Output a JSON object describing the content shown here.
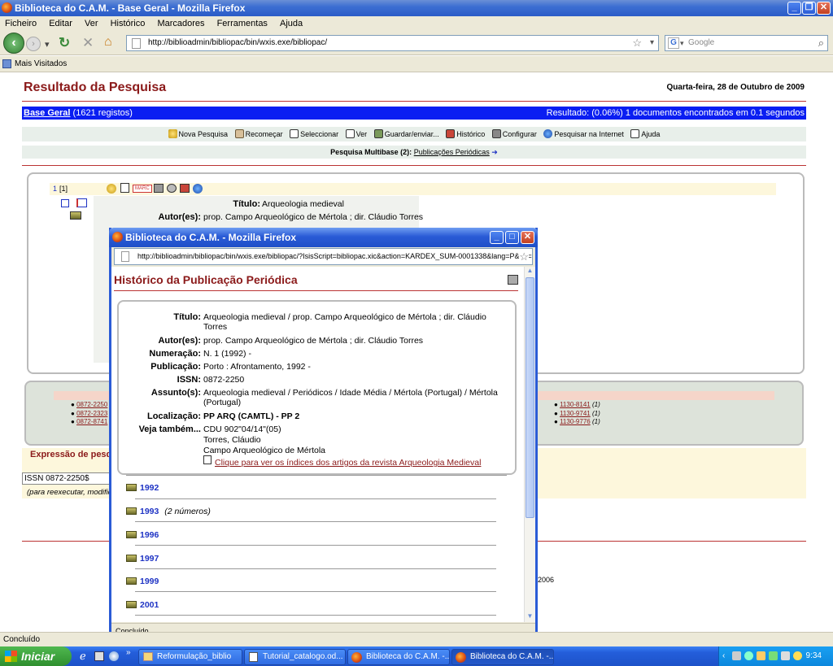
{
  "browser": {
    "window_title": "Biblioteca do C.A.M. - Base Geral - Mozilla Firefox",
    "menu": [
      "Ficheiro",
      "Editar",
      "Ver",
      "Histórico",
      "Marcadores",
      "Ferramentas",
      "Ajuda"
    ],
    "url": "http://biblioadmin/bibliopac/bin/wxis.exe/bibliopac/",
    "search_placeholder": "Google",
    "bookmark": "Mais Visitados",
    "status": "Concluído"
  },
  "page": {
    "title": "Resultado da Pesquisa",
    "date": "Quarta-feira, 28 de Outubro de 2009",
    "base_link": "Base Geral",
    "base_count": "(1621 registos)",
    "result_text": "Resultado: (0.06%) 1 documentos encontrados em 0.1 segundos",
    "toolbar": [
      "Nova Pesquisa",
      "Recomeçar",
      "Seleccionar",
      "Ver",
      "Guardar/enviar...",
      "Histórico",
      "Configurar",
      "Pesquisar na Internet",
      "Ajuda"
    ],
    "multibase_label": "Pesquisa Multibase (2):",
    "multibase_link": "Publicações Periódicas",
    "record_num": "1",
    "record_idx": "[1]",
    "marc_label": "MARC",
    "rec_title_label": "Título:",
    "rec_title_value": "Arqueologia medieval",
    "rec_author_label": "Autor(es):",
    "rec_author_value": "prop. Campo Arqueológico de Mértola ; dir. Cláudio Torres",
    "left_links": [
      "0872-2250",
      "0872-2323",
      "0872-8741"
    ],
    "right_links": [
      {
        "code": "1130-8141",
        "count": "(1)"
      },
      {
        "code": "1130-9741",
        "count": "(1)"
      },
      {
        "code": "1130-9776",
        "count": "(1)"
      }
    ],
    "expr_label": "Expressão de pesquisa",
    "issn_expr": "ISSN 0872-2250$",
    "reexec_note": "(para reexecutar, modifique...",
    "footer_partial": "-2006"
  },
  "popup": {
    "title": "Biblioteca do C.A.M. - Mozilla Firefox",
    "url": "http://biblioadmin/bibliopac/bin/wxis.exe/bibliopac/?IsisScript=bibliopac.xic&action=KARDEX_SUM-0001338&lang=P&db=E",
    "heading": "Histórico da Publicação Periódica",
    "fields": [
      {
        "label": "Título:",
        "value": "Arqueologia medieval / prop. Campo Arqueológico de Mértola ; dir. Cláudio Torres"
      },
      {
        "label": "Autor(es):",
        "value": "prop. Campo Arqueológico de Mértola ; dir. Cláudio Torres"
      },
      {
        "label": "Numeração:",
        "value": "N. 1 (1992) -"
      },
      {
        "label": "Publicação:",
        "value": "Porto : Afrontamento, 1992 -"
      },
      {
        "label": "ISSN:",
        "value": "0872-2250"
      },
      {
        "label": "Assunto(s):",
        "value": "Arqueologia medieval / Periódicos / Idade Média / Mértola (Portugal) / Mértola (Portugal)"
      },
      {
        "label": "Localização:",
        "value": "PP ARQ (CAMTL) - PP 2"
      },
      {
        "label": "Veja também...",
        "value": "CDU 902\"04/14\"(05)"
      }
    ],
    "see_also_extra": [
      "Torres, Cláudio",
      "Campo Arqueológico de Mértola"
    ],
    "index_link": "Clique para ver os índices dos artigos da revista Arqueologia Medieval",
    "years": [
      {
        "year": "1992",
        "note": ""
      },
      {
        "year": "1993",
        "note": "(2 números)"
      },
      {
        "year": "1996",
        "note": ""
      },
      {
        "year": "1997",
        "note": ""
      },
      {
        "year": "1999",
        "note": ""
      },
      {
        "year": "2001",
        "note": ""
      }
    ],
    "status": "Concluído"
  },
  "taskbar": {
    "start": "Iniciar",
    "tasks": [
      "Reformulação_biblio",
      "Tutorial_catalogo.od...",
      "Biblioteca do C.A.M. -...",
      "Biblioteca do C.A.M. -..."
    ],
    "clock": "9:34"
  }
}
